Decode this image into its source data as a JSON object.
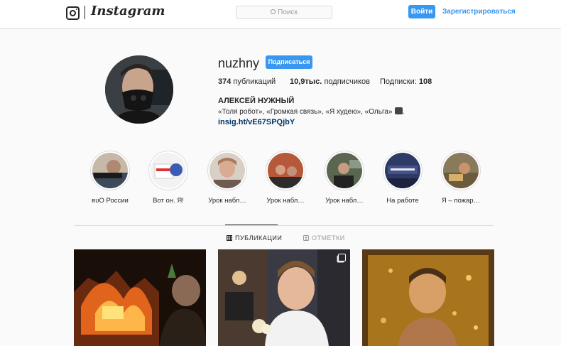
{
  "header": {
    "wordmark": "Instagram",
    "search_placeholder": "Поиск",
    "login_label": "Войти",
    "register_label": "Зарегистрироваться"
  },
  "profile": {
    "username": "nuzhny",
    "follow_label": "Подписаться",
    "posts_count": "374",
    "posts_label": "публикаций",
    "followers_count": "10,9тыс.",
    "followers_label": "подписчиков",
    "following_label": "Подписки:",
    "following_count": "108",
    "full_name": "АЛЕКСЕЙ НУЖНЫЙ",
    "bio": "«Толя робот», «Громкая связь», «Я худею», «Ольга»",
    "bio_link": "insig.ht/vE67SPQjbY"
  },
  "highlights": [
    {
      "label": "ʀᴜО России"
    },
    {
      "label": "Вот он. Я!"
    },
    {
      "label": "Урок набл…"
    },
    {
      "label": "Урок набл…"
    },
    {
      "label": "Урок набл…"
    },
    {
      "label": "На работе"
    },
    {
      "label": "Я – пожар…"
    }
  ],
  "tabs": [
    {
      "label": "ПУБЛИКАЦИИ",
      "active": true
    },
    {
      "label": "ОТМЕТКИ",
      "active": false
    }
  ],
  "colors": {
    "accent": "#3897f0",
    "link": "#003569",
    "border": "#dbdbdb",
    "background": "#fafafa"
  }
}
